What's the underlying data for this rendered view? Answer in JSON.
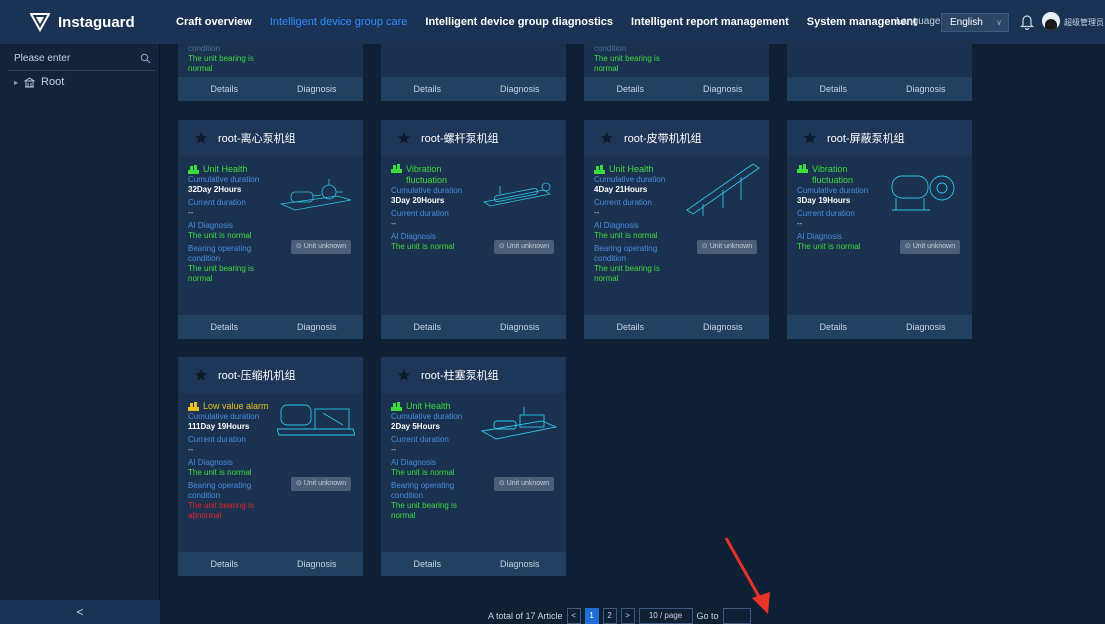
{
  "header": {
    "logo_text": "Instaguard",
    "nav": [
      {
        "label": "Craft overview",
        "active": false
      },
      {
        "label": "Intelligent device group care",
        "active": true
      },
      {
        "label": "Intelligent device group diagnostics",
        "active": false
      },
      {
        "label": "Intelligent report management",
        "active": false
      },
      {
        "label": "System management",
        "active": false
      }
    ],
    "language_label": "Language",
    "language_value": "English",
    "username": "超级管理员"
  },
  "sidebar": {
    "search_placeholder": "Please enter",
    "tree_root": "Root",
    "collapse_glyph": "<"
  },
  "cards_top_partial": [
    {
      "cut_label": "condition",
      "bearing_ok": "The unit bearing is",
      "bearing_ok2": "normal",
      "details": "Details",
      "diagnosis": "Diagnosis"
    },
    {
      "details": "Details",
      "diagnosis": "Diagnosis"
    },
    {
      "cut_label": "condition",
      "bearing_ok": "The unit bearing is",
      "bearing_ok2": "normal",
      "details": "Details",
      "diagnosis": "Diagnosis"
    },
    {
      "details": "Details",
      "diagnosis": "Diagnosis"
    }
  ],
  "cards": [
    {
      "title": "root-离心泵机组",
      "status": "Unit Health",
      "status_color": "#3ddc3d",
      "cum_label": "Cumulative duration",
      "cum_value": "32Day 2Hours",
      "cur_label": "Current duration",
      "cur_value": "--",
      "ai_label": "AI Diagnosis",
      "ai_value": "The unit is normal",
      "bearing_label": "Bearing operating condition",
      "bearing_value": "The unit bearing is normal",
      "bearing_bad": false,
      "unknown_btn": "Unit unknown",
      "details": "Details",
      "diagnosis": "Diagnosis"
    },
    {
      "title": "root-螺杆泵机组",
      "status": "Vibration fluctuation",
      "status_color": "#3ddc3d",
      "cum_label": "Cumulative duration",
      "cum_value": "3Day 20Hours",
      "cur_label": "Current duration",
      "cur_value": "--",
      "ai_label": "AI Diagnosis",
      "ai_value": "The unit is normal",
      "unknown_btn": "Unit unknown",
      "details": "Details",
      "diagnosis": "Diagnosis"
    },
    {
      "title": "root-皮带机机组",
      "status": "Unit Health",
      "status_color": "#3ddc3d",
      "cum_label": "Cumulative duration",
      "cum_value": "4Day 21Hours",
      "cur_label": "Current duration",
      "cur_value": "--",
      "ai_label": "AI Diagnosis",
      "ai_value": "The unit is normal",
      "bearing_label": "Bearing operating condition",
      "bearing_value": "The unit bearing is normal",
      "bearing_bad": false,
      "unknown_btn": "Unit unknown",
      "details": "Details",
      "diagnosis": "Diagnosis"
    },
    {
      "title": "root-屏蔽泵机组",
      "status": "Vibration fluctuation",
      "status_color": "#3ddc3d",
      "cum_label": "Cumulative duration",
      "cum_value": "3Day 19Hours",
      "cur_label": "Current duration",
      "cur_value": "--",
      "ai_label": "AI Diagnosis",
      "ai_value": "The unit is normal",
      "unknown_btn": "Unit unknown",
      "details": "Details",
      "diagnosis": "Diagnosis"
    },
    {
      "title": "root-压缩机机组",
      "status": "Low value alarm",
      "status_color": "#e8c21a",
      "cum_label": "Cumulative duration",
      "cum_value": "111Day 19Hours",
      "cur_label": "Current duration",
      "cur_value": "--",
      "ai_label": "AI Diagnosis",
      "ai_value": "The unit is normal",
      "bearing_label": "Bearing operating condition",
      "bearing_value": "The unit bearing is abnormal",
      "bearing_bad": true,
      "unknown_btn": "Unit unknown",
      "details": "Details",
      "diagnosis": "Diagnosis"
    },
    {
      "title": "root-柱塞泵机组",
      "status": "Unit Health",
      "status_color": "#3ddc3d",
      "cum_label": "Cumulative duration",
      "cum_value": "2Day 5Hours",
      "cur_label": "Current duration",
      "cur_value": "--",
      "ai_label": "AI Diagnosis",
      "ai_value": "The unit is normal",
      "bearing_label": "Bearing operating condition",
      "bearing_value": "The unit bearing is normal",
      "bearing_bad": false,
      "unknown_btn": "Unit unknown",
      "details": "Details",
      "diagnosis": "Diagnosis"
    }
  ],
  "pagination": {
    "total_text": "A total of 17 Article",
    "prev": "<",
    "pages": [
      "1",
      "2"
    ],
    "current_page": "1",
    "next": ">",
    "page_size": "10 / page",
    "goto_label": "Go to"
  },
  "colors": {
    "accent": "#2f8eff",
    "ok": "#3ddc3d",
    "bad": "#e02424",
    "warn": "#e8c21a",
    "annotation_arrow": "#e8322a"
  }
}
